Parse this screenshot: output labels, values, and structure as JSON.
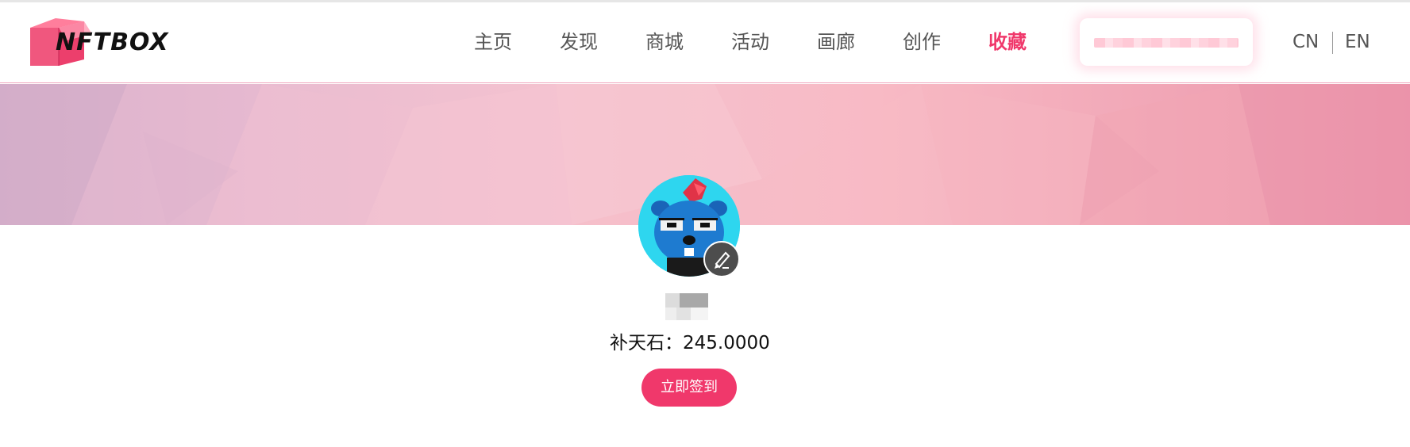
{
  "header": {
    "logo_text": "NFTBOX",
    "nav": [
      {
        "label": "主页"
      },
      {
        "label": "发现"
      },
      {
        "label": "商城"
      },
      {
        "label": "活动"
      },
      {
        "label": "画廊"
      },
      {
        "label": "创作"
      },
      {
        "label": "收藏",
        "active": true
      }
    ],
    "lang_cn": "CN",
    "lang_en": "EN"
  },
  "profile": {
    "balance_label": "补天石：",
    "balance_value": "245.0000",
    "signin_label": "立即签到"
  },
  "colors": {
    "accent": "#f0386b",
    "avatar_bg": "#2ed6ef",
    "banner_left": "#d8b2cc",
    "banner_right": "#ec93aa"
  },
  "icons": {
    "edit": "pencil-icon"
  }
}
